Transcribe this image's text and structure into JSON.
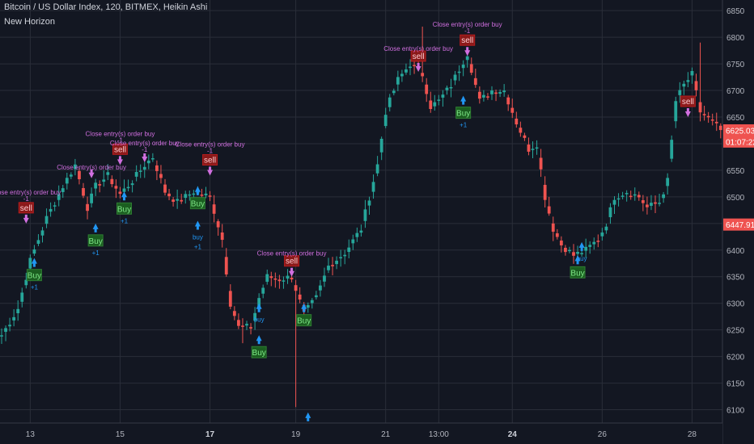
{
  "header": {
    "title": "Bitcoin / US Dollar Index, 120, BITMEX, Heikin Ashi",
    "study": "New Horizon"
  },
  "colors": {
    "background": "#131722",
    "grid": "#2a2e39",
    "up": "#26a69a",
    "down": "#ef5350",
    "axis_text": "#b2b5be",
    "strategy_text": "#d16fe0",
    "buy_arrow": "#2196f3",
    "sell_arrow": "#d16fe0",
    "buy_label_bg": "#1b5e20",
    "buy_label_fg": "#7ee787",
    "sell_label_bg": "#8b1a1a",
    "sell_label_fg": "#ffcdd2",
    "price_badge_red": "#ef5350"
  },
  "chart_data": {
    "type": "candlestick",
    "ylim": [
      6075,
      6870
    ],
    "y_ticks": [
      6100,
      6150,
      6200,
      6250,
      6300,
      6350,
      6400,
      6450,
      6500,
      6550,
      6600,
      6650,
      6700,
      6750,
      6800,
      6850
    ],
    "x_ticks": [
      {
        "label": "13",
        "bar": 7,
        "bold": false
      },
      {
        "label": "15",
        "bar": 29,
        "bold": false
      },
      {
        "label": "17",
        "bar": 51,
        "bold": true
      },
      {
        "label": "19",
        "bar": 72,
        "bold": false
      },
      {
        "label": "21",
        "bar": 94,
        "bold": false
      },
      {
        "label": "13:00",
        "bar": 107,
        "bold": false
      },
      {
        "label": "24",
        "bar": 125,
        "bold": true
      },
      {
        "label": "26",
        "bar": 147,
        "bold": false
      },
      {
        "label": "28",
        "bar": 169,
        "bold": false
      }
    ],
    "price_badges": [
      {
        "label": "6625.03",
        "value": 6625,
        "note": ""
      },
      {
        "label": "01:07:22",
        "value": 6604,
        "note": ""
      },
      {
        "label": "6447.91",
        "value": 6448,
        "note": ""
      }
    ],
    "path": [
      [
        0,
        6240
      ],
      [
        4,
        6290
      ],
      [
        7,
        6380
      ],
      [
        11,
        6460
      ],
      [
        15,
        6520
      ],
      [
        18,
        6560
      ],
      [
        21,
        6480
      ],
      [
        23,
        6520
      ],
      [
        26,
        6540
      ],
      [
        29,
        6505
      ],
      [
        32,
        6530
      ],
      [
        35,
        6560
      ],
      [
        37,
        6575
      ],
      [
        40,
        6510
      ],
      [
        43,
        6490
      ],
      [
        47,
        6510
      ],
      [
        51,
        6500
      ],
      [
        54,
        6420
      ],
      [
        56,
        6300
      ],
      [
        58,
        6255
      ],
      [
        61,
        6255
      ],
      [
        63,
        6310
      ],
      [
        65,
        6350
      ],
      [
        68,
        6345
      ],
      [
        71,
        6350
      ],
      [
        74,
        6280
      ],
      [
        77,
        6310
      ],
      [
        80,
        6370
      ],
      [
        84,
        6395
      ],
      [
        88,
        6440
      ],
      [
        92,
        6560
      ],
      [
        94,
        6660
      ],
      [
        97,
        6720
      ],
      [
        100,
        6750
      ],
      [
        103,
        6730
      ],
      [
        105,
        6670
      ],
      [
        107,
        6680
      ],
      [
        110,
        6710
      ],
      [
        114,
        6770
      ],
      [
        117,
        6680
      ],
      [
        120,
        6700
      ],
      [
        123,
        6700
      ],
      [
        126,
        6640
      ],
      [
        129,
        6590
      ],
      [
        131,
        6600
      ],
      [
        133,
        6500
      ],
      [
        135,
        6440
      ],
      [
        137,
        6410
      ],
      [
        140,
        6390
      ],
      [
        143,
        6400
      ],
      [
        146,
        6420
      ],
      [
        148,
        6450
      ],
      [
        150,
        6500
      ],
      [
        153,
        6510
      ],
      [
        156,
        6500
      ],
      [
        158,
        6480
      ],
      [
        161,
        6490
      ],
      [
        163,
        6530
      ],
      [
        165,
        6680
      ],
      [
        167,
        6710
      ],
      [
        169,
        6730
      ],
      [
        171,
        6660
      ],
      [
        174,
        6640
      ],
      [
        176,
        6625
      ]
    ],
    "spikes": [
      {
        "bar": 72,
        "low": 6105
      },
      {
        "bar": 103,
        "high": 6820
      },
      {
        "bar": 59,
        "low": 6225
      },
      {
        "bar": 171,
        "high": 6790
      }
    ],
    "signals": [
      {
        "type": "buy",
        "bar": 8,
        "value": 6385,
        "label": "Buy",
        "sub": "+1"
      },
      {
        "type": "buy",
        "bar": 23,
        "value": 6450,
        "label": "Buy",
        "sub": "+1"
      },
      {
        "type": "buy",
        "bar": 30,
        "value": 6510,
        "label": "Buy",
        "sub": "+1"
      },
      {
        "type": "buy",
        "bar": 48,
        "value": 6455,
        "label": "buy",
        "sub": "+1"
      },
      {
        "type": "buy",
        "bar": 48,
        "value": 6520,
        "label": "Buy",
        "sub": ""
      },
      {
        "type": "buy",
        "bar": 63,
        "value": 6300,
        "label": "buy",
        "sub": ""
      },
      {
        "type": "buy",
        "bar": 63,
        "value": 6240,
        "label": "Buy",
        "sub": ""
      },
      {
        "type": "buy",
        "bar": 74,
        "value": 6300,
        "label": "Buy",
        "sub": ""
      },
      {
        "type": "buy",
        "bar": 75,
        "value": 6095,
        "label": "",
        "sub": ""
      },
      {
        "type": "buy",
        "bar": 113,
        "value": 6690,
        "label": "Buy",
        "sub": "+1"
      },
      {
        "type": "buy",
        "bar": 142,
        "value": 6415,
        "label": "buy",
        "sub": ""
      },
      {
        "type": "buy",
        "bar": 141,
        "value": 6390,
        "label": "Buy",
        "sub": ""
      },
      {
        "type": "sell",
        "bar": 6,
        "value": 6450,
        "label": "sell",
        "sub": "-1",
        "note": "Close entry(s) order buy"
      },
      {
        "type": "sell",
        "bar": 22,
        "value": 6535,
        "label": "",
        "sub": "",
        "note": "Close entry(s) order buy"
      },
      {
        "type": "sell",
        "bar": 29,
        "value": 6560,
        "label": "sell",
        "sub": "-1",
        "note": "Close entry(s) order buy"
      },
      {
        "type": "sell",
        "bar": 35,
        "value": 6565,
        "label": "",
        "sub": "-1",
        "note": "Close entry(s) order buy"
      },
      {
        "type": "sell",
        "bar": 51,
        "value": 6540,
        "label": "sell",
        "sub": "-1",
        "note": "Close entry(s) order buy"
      },
      {
        "type": "sell",
        "bar": 71,
        "value": 6350,
        "label": "sell",
        "sub": "",
        "note": "Close entry(s) order buy"
      },
      {
        "type": "sell",
        "bar": 102,
        "value": 6735,
        "label": "sell",
        "sub": "",
        "note": "Close entry(s) order buy"
      },
      {
        "type": "sell",
        "bar": 114,
        "value": 6765,
        "label": "sell",
        "sub": "-1",
        "note": "Close entry(s) order buy"
      },
      {
        "type": "sell",
        "bar": 168,
        "value": 6650,
        "label": "sell",
        "sub": "",
        "note": ""
      }
    ]
  }
}
